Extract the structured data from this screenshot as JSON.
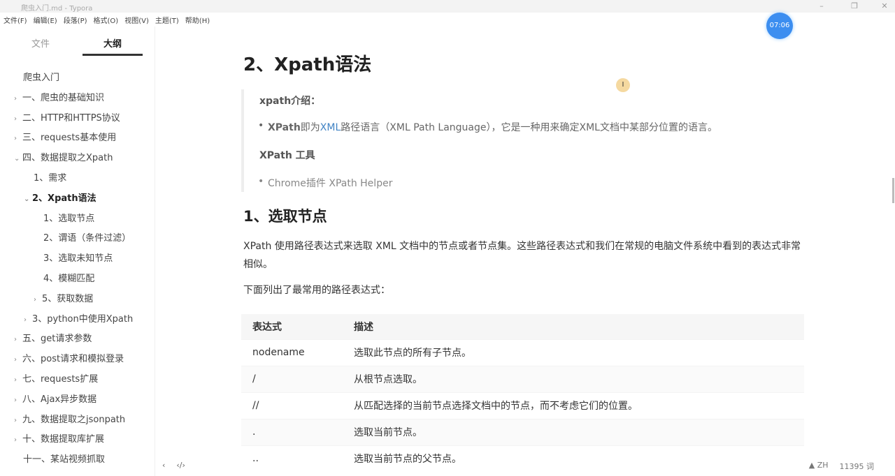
{
  "window": {
    "title": "爬虫入门.md - Typora"
  },
  "menu": [
    "文件(F)",
    "编辑(E)",
    "段落(P)",
    "格式(O)",
    "视图(V)",
    "主题(T)",
    "帮助(H)"
  ],
  "sidebar": {
    "tabs": [
      "文件",
      "大纲"
    ],
    "items": [
      {
        "label": "爬虫入门",
        "level": 0,
        "chev": ""
      },
      {
        "label": "一、爬虫的基础知识",
        "level": 1,
        "chev": "›"
      },
      {
        "label": "二、HTTP和HTTPS协议",
        "level": 1,
        "chev": "›"
      },
      {
        "label": "三、requests基本使用",
        "level": 1,
        "chev": "›"
      },
      {
        "label": "四、数据提取之Xpath",
        "level": 1,
        "chev": "⌄"
      },
      {
        "label": "1、需求",
        "level": 2,
        "chev": ""
      },
      {
        "label": "2、Xpath语法",
        "level": 2,
        "chev": "⌄",
        "active": true
      },
      {
        "label": "1、选取节点",
        "level": 3,
        "chev": ""
      },
      {
        "label": "2、谓语（条件过滤）",
        "level": 3,
        "chev": ""
      },
      {
        "label": "3、选取未知节点",
        "level": 3,
        "chev": ""
      },
      {
        "label": "4、模糊匹配",
        "level": 3,
        "chev": ""
      },
      {
        "label": "5、获取数据",
        "level": 3,
        "chev": "›"
      },
      {
        "label": "3、python中使用Xpath",
        "level": 2,
        "chev": "›"
      },
      {
        "label": "五、get请求参数",
        "level": 1,
        "chev": "›"
      },
      {
        "label": "六、post请求和模拟登录",
        "level": 1,
        "chev": "›"
      },
      {
        "label": "七、requests扩展",
        "level": 1,
        "chev": "›"
      },
      {
        "label": "八、Ajax异步数据",
        "level": 1,
        "chev": "›"
      },
      {
        "label": "九、数据提取之jsonpath",
        "level": 1,
        "chev": "›"
      },
      {
        "label": "十、数据提取库扩展",
        "level": 1,
        "chev": "›"
      },
      {
        "label": "十一、某站视频抓取",
        "level": 1,
        "chev": ""
      }
    ]
  },
  "timer": "07:06",
  "doc": {
    "h2": "2、Xpath语法",
    "bq": {
      "h1": "xpath介绍：",
      "li1_bold": "XPath",
      "li1_a": "即为",
      "li1_link": "XML",
      "li1_b": "路径语言（XML Path Language），它是一种用来确定XML文档中某部分位置的语言。",
      "h2": "XPath 工具",
      "li2": "Chrome插件 XPath Helper"
    },
    "h3": "1、选取节点",
    "p1": "XPath 使用路径表达式来选取 XML 文档中的节点或者节点集。这些路径表达式和我们在常规的电脑文件系统中看到的表达式非常相似。",
    "p2": "下面列出了最常用的路径表达式：",
    "table": {
      "headers": [
        "表达式",
        "描述"
      ],
      "rows": [
        [
          "nodename",
          "选取此节点的所有子节点。"
        ],
        [
          "/",
          "从根节点选取。"
        ],
        [
          "//",
          "从匹配选择的当前节点选择文档中的节点，而不考虑它们的位置。"
        ],
        [
          ".",
          "选取当前节点。"
        ],
        [
          "..",
          "选取当前节点的父节点。"
        ]
      ]
    }
  },
  "status": {
    "lang": "ZH",
    "words": "11395 词"
  },
  "footer": {
    "back": "‹",
    "source": "‹/›"
  }
}
